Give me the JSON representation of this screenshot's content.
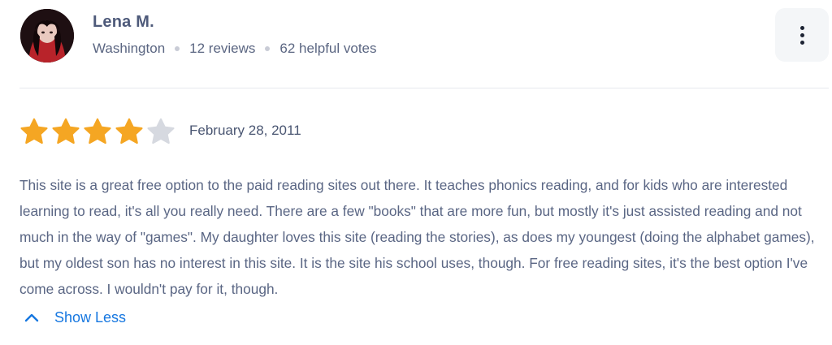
{
  "reviewer": {
    "name": "Lena M.",
    "location": "Washington",
    "reviews_count": "12 reviews",
    "helpful_votes": "62 helpful votes"
  },
  "menu": {
    "icon": "more-vertical-icon"
  },
  "review": {
    "rating": 4,
    "max_rating": 5,
    "date": "February 28, 2011",
    "text": "This site is a great free option to the paid reading sites out there. It teaches phonics reading, and for kids who are interested learning to read, it's all you really need. There are a few \"books\" that are more fun, but mostly it's just assisted reading and not much in the way of \"games\". My daughter loves this site (reading the stories), as does my youngest (doing the alphabet games), but my oldest son has no interest in this site. It is the site his school uses, though. For free reading sites, it's the best option I've come across. I wouldn't pay for it, though."
  },
  "toggle": {
    "label": "Show Less",
    "icon": "chevron-up-icon"
  },
  "colors": {
    "star_filled": "#f5a623",
    "star_empty": "#d6d9e0",
    "link": "#1677e0",
    "text": "#5a6684"
  }
}
